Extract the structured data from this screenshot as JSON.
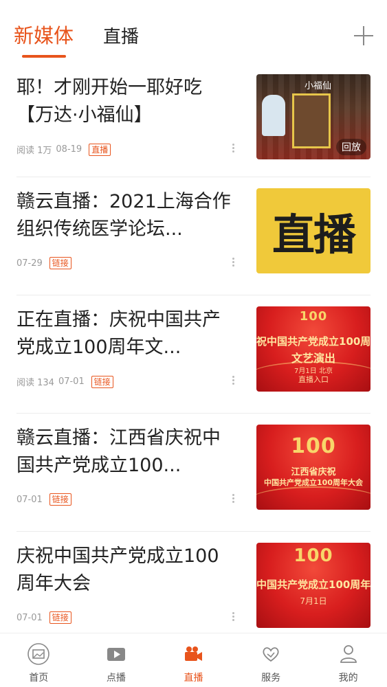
{
  "header": {
    "tabs": [
      {
        "label": "新媒体",
        "active": true
      },
      {
        "label": "直播",
        "active": false
      }
    ],
    "add_icon": "plus-icon"
  },
  "feed": [
    {
      "title": "耶！才刚开始一耶好吃【万达·小福仙】",
      "views": "阅读 1万",
      "date": "08-19",
      "badge": "直播",
      "thumb": {
        "style": "restaurant",
        "sign": "小福仙",
        "overlay": "回放"
      }
    },
    {
      "title": "赣云直播：2021上海合作组织传统医学论坛...",
      "views": "",
      "date": "07-29",
      "badge": "链接",
      "thumb": {
        "style": "yellow-text",
        "text": "直播"
      }
    },
    {
      "title": "正在直播：庆祝中国共产党成立100周年文...",
      "views": "阅读 134",
      "date": "07-01",
      "badge": "链接",
      "thumb": {
        "style": "red",
        "emblem": "100",
        "line1": "祝中国共产党成立100周",
        "line2": "文艺演出",
        "small1": "7月1日 北京",
        "small2": "直播入口"
      }
    },
    {
      "title": "赣云直播：江西省庆祝中国共产党成立100...",
      "views": "",
      "date": "07-01",
      "badge": "链接",
      "thumb": {
        "style": "red",
        "emblem": "100",
        "line1": "江西省庆祝",
        "line2": "中国共产党成立100周年大会"
      }
    },
    {
      "title": "庆祝中国共产党成立100周年大会",
      "views": "",
      "date": "07-01",
      "badge": "链接",
      "thumb": {
        "style": "red",
        "emblem": "100",
        "line1": "中国共产党成立100周年",
        "small1": "7月1日"
      }
    }
  ],
  "bottom_nav": [
    {
      "label": "首页",
      "icon": "photo-icon",
      "active": false
    },
    {
      "label": "点播",
      "icon": "play-icon",
      "active": false
    },
    {
      "label": "直播",
      "icon": "video-camera-icon",
      "active": true
    },
    {
      "label": "服务",
      "icon": "heart-hands-icon",
      "active": false
    },
    {
      "label": "我的",
      "icon": "person-icon",
      "active": false
    }
  ],
  "colors": {
    "accent": "#e8541c",
    "text": "#222222",
    "muted": "#999999"
  }
}
